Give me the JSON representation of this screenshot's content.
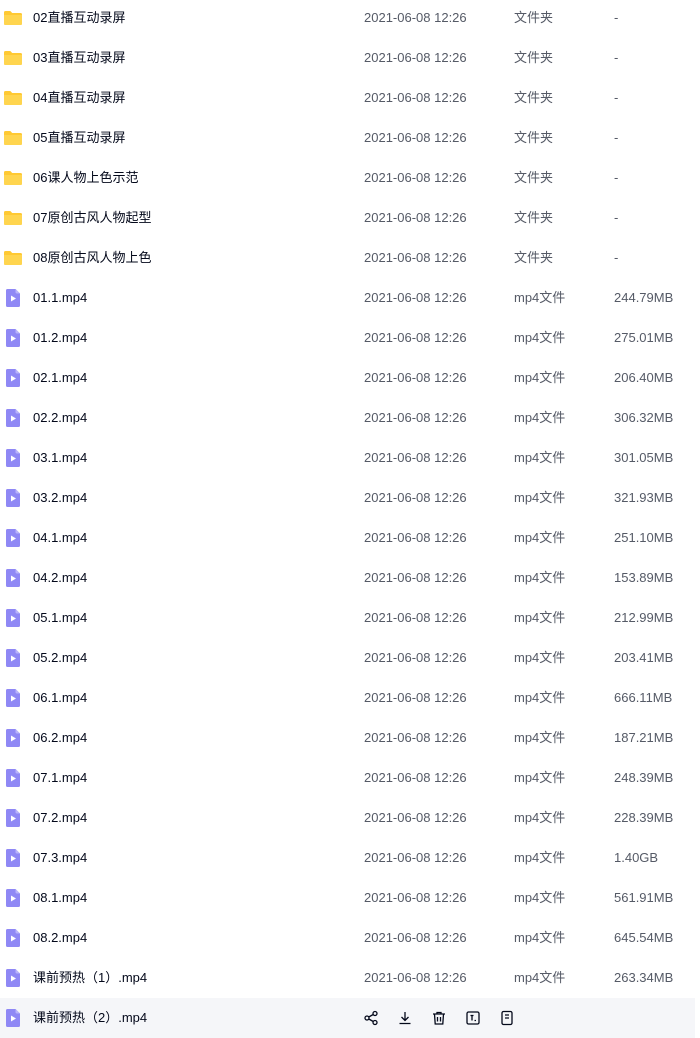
{
  "colors": {
    "folder": "#ffc933",
    "video": "#8f88f5",
    "text_primary": "#03081a",
    "text_secondary": "#555a66",
    "hover_row": "#f5f6f9"
  },
  "files": [
    {
      "name": "02直播互动录屏",
      "date": "2021-06-08 12:26",
      "type": "文件夹",
      "size": "-",
      "icon": "folder-icon"
    },
    {
      "name": "03直播互动录屏",
      "date": "2021-06-08 12:26",
      "type": "文件夹",
      "size": "-",
      "icon": "folder-icon"
    },
    {
      "name": "04直播互动录屏",
      "date": "2021-06-08 12:26",
      "type": "文件夹",
      "size": "-",
      "icon": "folder-icon"
    },
    {
      "name": "05直播互动录屏",
      "date": "2021-06-08 12:26",
      "type": "文件夹",
      "size": "-",
      "icon": "folder-icon"
    },
    {
      "name": "06课人物上色示范",
      "date": "2021-06-08 12:26",
      "type": "文件夹",
      "size": "-",
      "icon": "folder-icon"
    },
    {
      "name": "07原创古风人物起型",
      "date": "2021-06-08 12:26",
      "type": "文件夹",
      "size": "-",
      "icon": "folder-icon"
    },
    {
      "name": "08原创古风人物上色",
      "date": "2021-06-08 12:26",
      "type": "文件夹",
      "size": "-",
      "icon": "folder-icon"
    },
    {
      "name": "01.1.mp4",
      "date": "2021-06-08 12:26",
      "type": "mp4文件",
      "size": "244.79MB",
      "icon": "video-file-icon"
    },
    {
      "name": "01.2.mp4",
      "date": "2021-06-08 12:26",
      "type": "mp4文件",
      "size": "275.01MB",
      "icon": "video-file-icon"
    },
    {
      "name": "02.1.mp4",
      "date": "2021-06-08 12:26",
      "type": "mp4文件",
      "size": "206.40MB",
      "icon": "video-file-icon"
    },
    {
      "name": "02.2.mp4",
      "date": "2021-06-08 12:26",
      "type": "mp4文件",
      "size": "306.32MB",
      "icon": "video-file-icon"
    },
    {
      "name": "03.1.mp4",
      "date": "2021-06-08 12:26",
      "type": "mp4文件",
      "size": "301.05MB",
      "icon": "video-file-icon"
    },
    {
      "name": "03.2.mp4",
      "date": "2021-06-08 12:26",
      "type": "mp4文件",
      "size": "321.93MB",
      "icon": "video-file-icon"
    },
    {
      "name": "04.1.mp4",
      "date": "2021-06-08 12:26",
      "type": "mp4文件",
      "size": "251.10MB",
      "icon": "video-file-icon"
    },
    {
      "name": "04.2.mp4",
      "date": "2021-06-08 12:26",
      "type": "mp4文件",
      "size": "153.89MB",
      "icon": "video-file-icon"
    },
    {
      "name": "05.1.mp4",
      "date": "2021-06-08 12:26",
      "type": "mp4文件",
      "size": "212.99MB",
      "icon": "video-file-icon"
    },
    {
      "name": "05.2.mp4",
      "date": "2021-06-08 12:26",
      "type": "mp4文件",
      "size": "203.41MB",
      "icon": "video-file-icon"
    },
    {
      "name": "06.1.mp4",
      "date": "2021-06-08 12:26",
      "type": "mp4文件",
      "size": "666.11MB",
      "icon": "video-file-icon"
    },
    {
      "name": "06.2.mp4",
      "date": "2021-06-08 12:26",
      "type": "mp4文件",
      "size": "187.21MB",
      "icon": "video-file-icon"
    },
    {
      "name": "07.1.mp4",
      "date": "2021-06-08 12:26",
      "type": "mp4文件",
      "size": "248.39MB",
      "icon": "video-file-icon"
    },
    {
      "name": "07.2.mp4",
      "date": "2021-06-08 12:26",
      "type": "mp4文件",
      "size": "228.39MB",
      "icon": "video-file-icon"
    },
    {
      "name": "07.3.mp4",
      "date": "2021-06-08 12:26",
      "type": "mp4文件",
      "size": "1.40GB",
      "icon": "video-file-icon"
    },
    {
      "name": "08.1.mp4",
      "date": "2021-06-08 12:26",
      "type": "mp4文件",
      "size": "561.91MB",
      "icon": "video-file-icon"
    },
    {
      "name": "08.2.mp4",
      "date": "2021-06-08 12:26",
      "type": "mp4文件",
      "size": "645.54MB",
      "icon": "video-file-icon"
    },
    {
      "name": "课前预热（1）.mp4",
      "date": "2021-06-08 12:26",
      "type": "mp4文件",
      "size": "263.34MB",
      "icon": "video-file-icon"
    }
  ],
  "hovered_file": {
    "name": "课前预热（2）.mp4",
    "icon": "video-file-icon",
    "actions": [
      "share-icon",
      "download-icon",
      "delete-icon",
      "rename-icon",
      "more-icon"
    ]
  }
}
